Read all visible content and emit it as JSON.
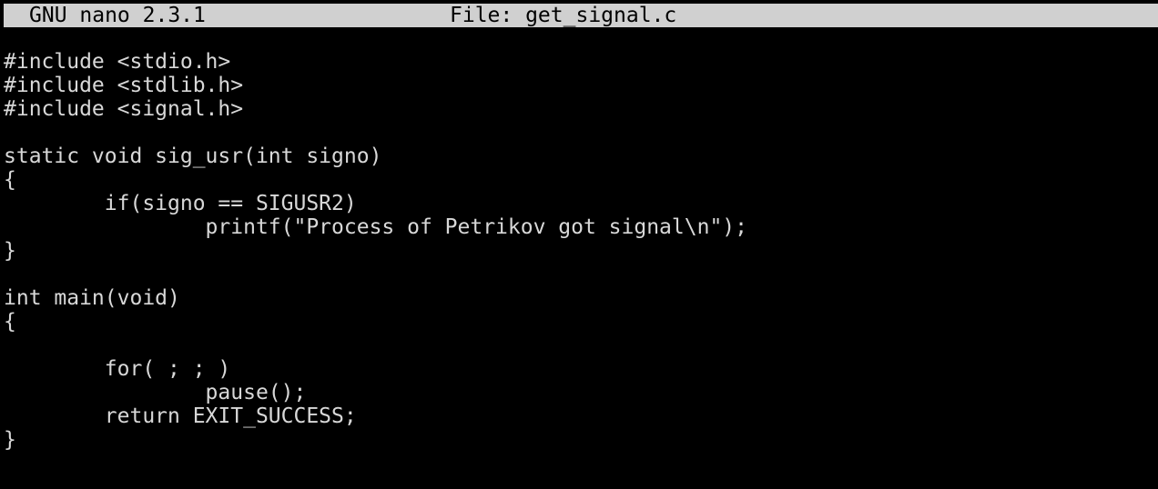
{
  "titlebar": {
    "version": "GNU nano 2.3.1",
    "file": "File: get_signal.c"
  },
  "editor": {
    "lines": [
      "#include <stdio.h>",
      "#include <stdlib.h>",
      "#include <signal.h>",
      "",
      "static void sig_usr(int signo)",
      "{",
      "        if(signo == SIGUSR2)",
      "                printf(\"Process of Petrikov got signal\\n\");",
      "}",
      "",
      "int main(void)",
      "{",
      "",
      "        for( ; ; )",
      "                pause();",
      "        return EXIT_SUCCESS;",
      "}"
    ]
  },
  "colors": {
    "background": "#000000",
    "text": "#d8d8d8",
    "titlebar_bg": "#d0d0d0",
    "titlebar_text": "#000000"
  }
}
